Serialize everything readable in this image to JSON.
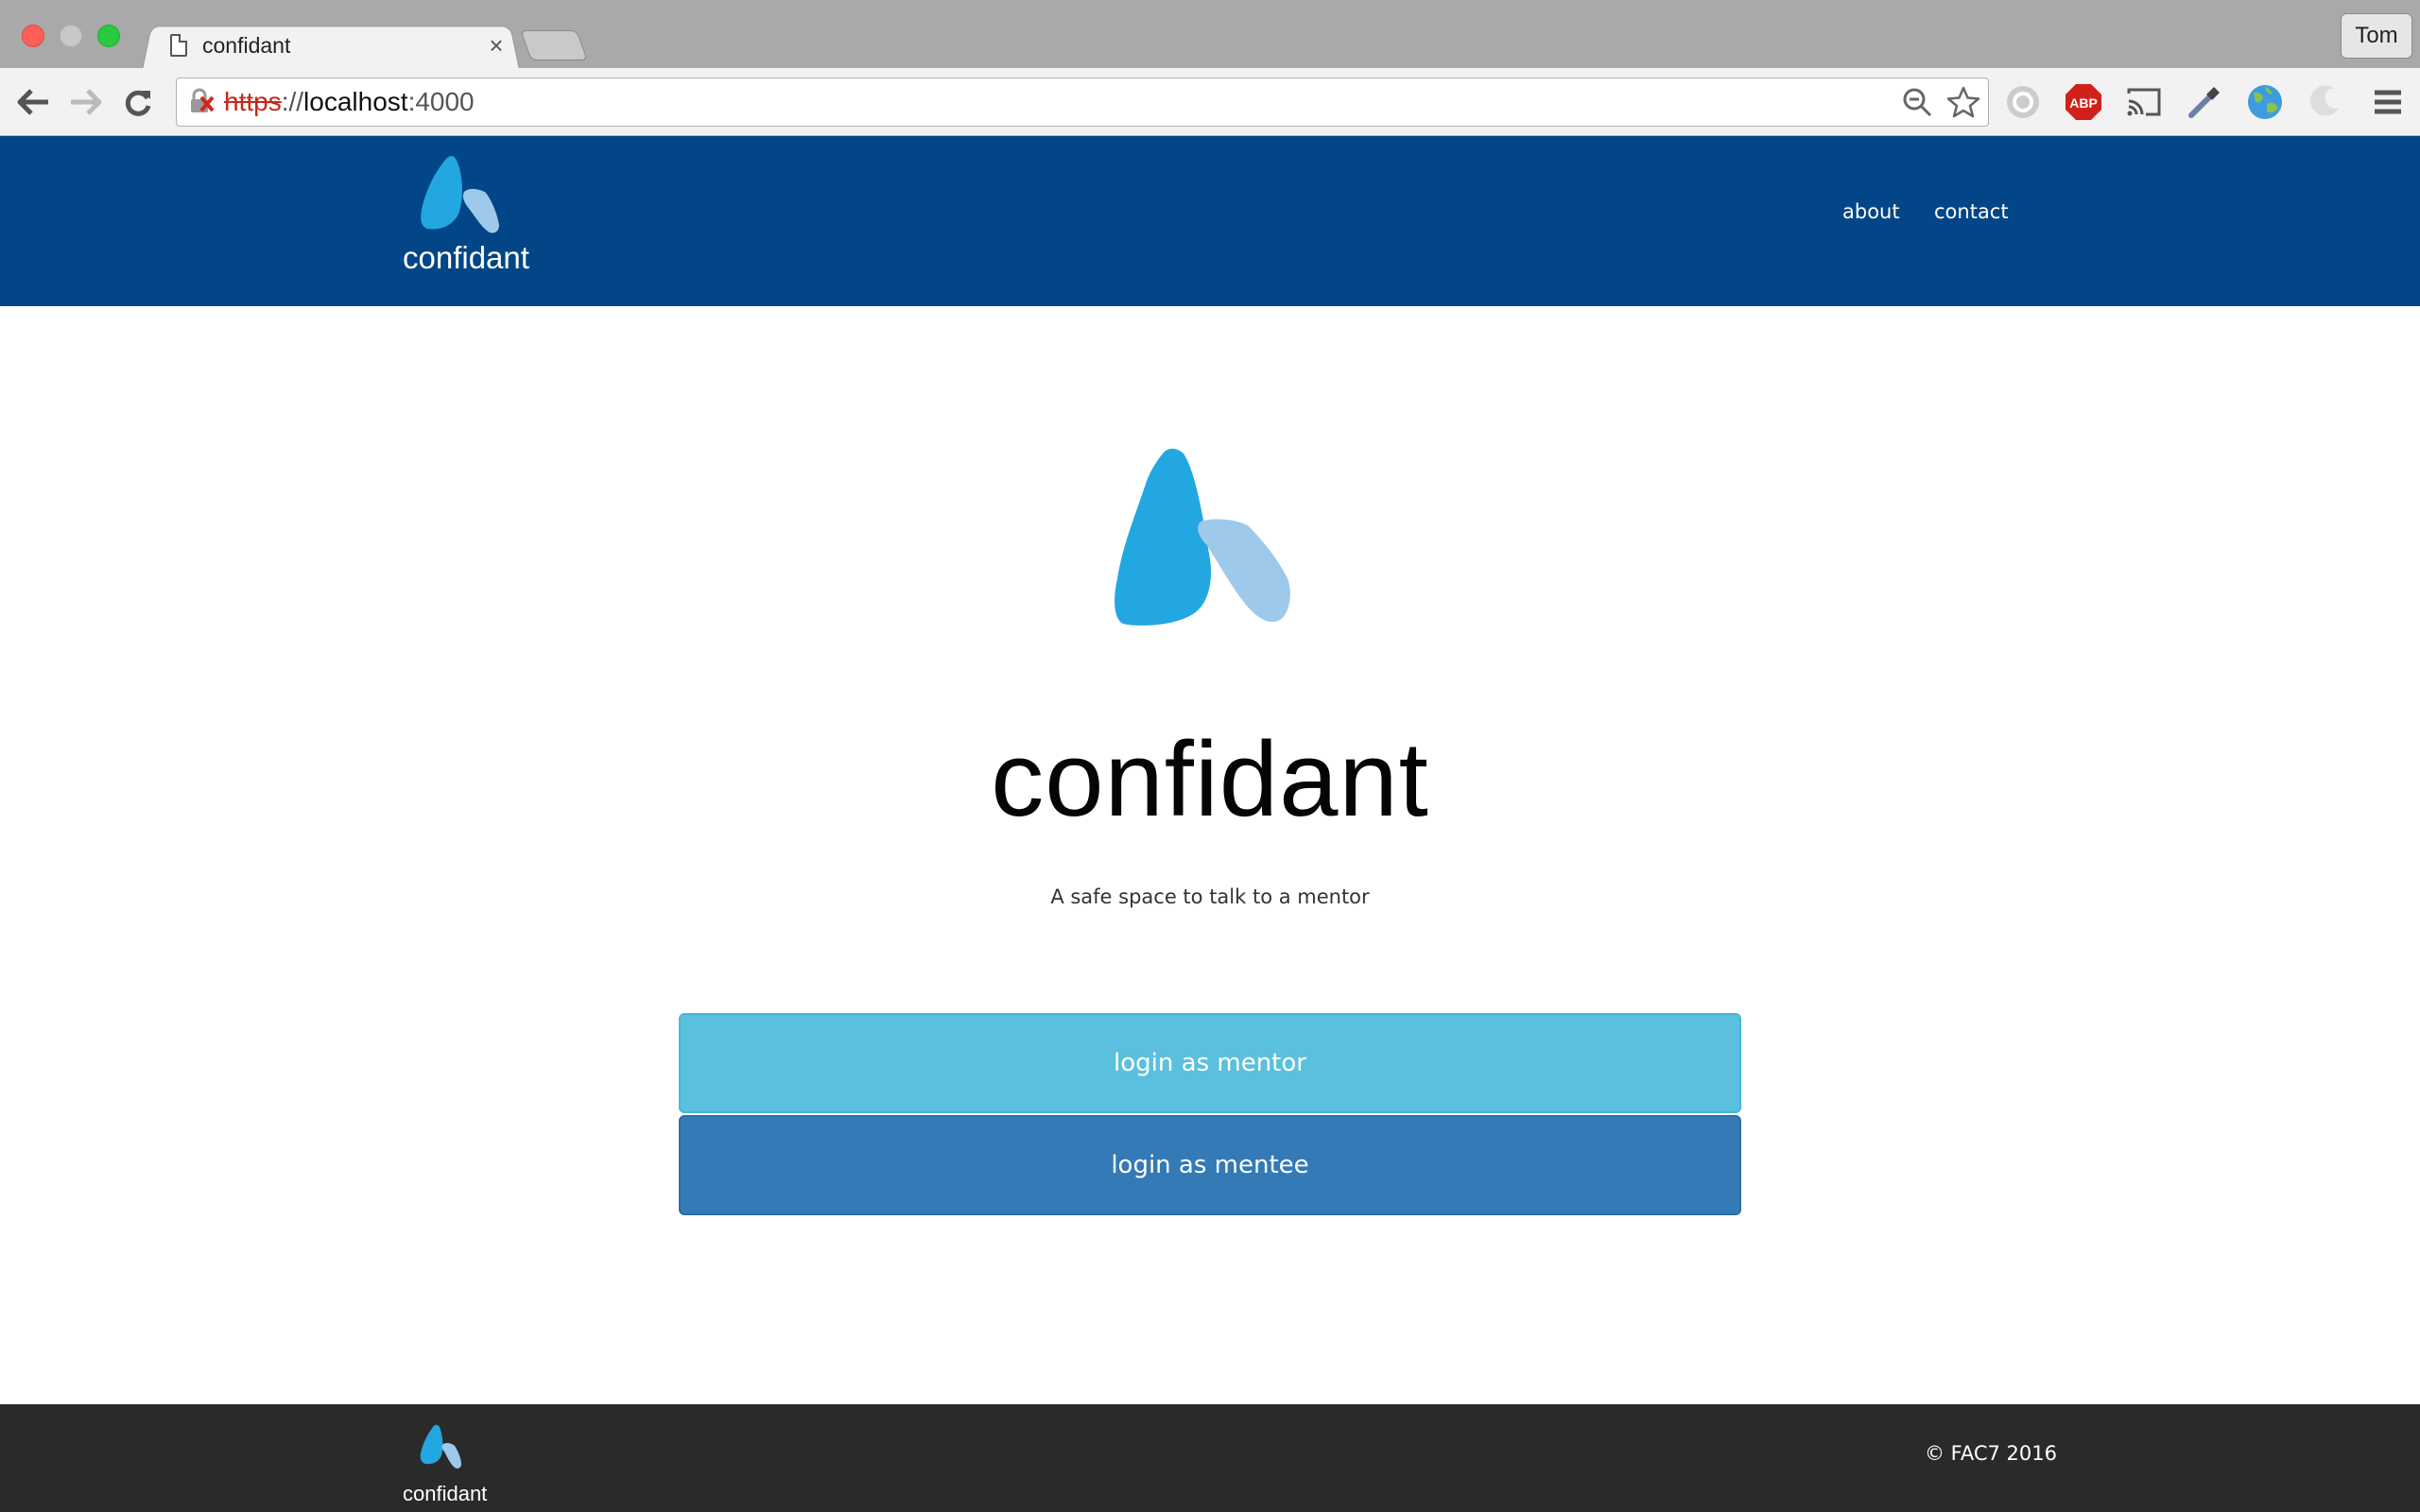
{
  "browser": {
    "tab_title": "confidant",
    "tab_close": "×",
    "profile_name": "Tom",
    "url": {
      "scheme": "https",
      "sep": "://",
      "host": "localhost",
      "port": ":4000"
    },
    "extensions": [
      "zoom-icon",
      "bookmark-star-icon",
      "extension-grey-icon",
      "adblock-icon",
      "cast-icon",
      "eyedropper-icon",
      "globe-icon",
      "extension-swirl-icon",
      "menu-icon"
    ],
    "adblock_label": "ABP"
  },
  "header": {
    "logo_text": "confidant",
    "nav": [
      {
        "label": "about"
      },
      {
        "label": "contact"
      }
    ]
  },
  "hero": {
    "title": "confidant",
    "tagline": "A safe space to talk to a mentor"
  },
  "actions": {
    "mentor_label": "login as mentor",
    "mentee_label": "login as mentee"
  },
  "footer": {
    "logo_text": "confidant",
    "copyright": "© FAC7 2016"
  },
  "colors": {
    "header_bg": "#034687",
    "footer_bg": "#2a2a2a",
    "logo_dark": "#22a7e1",
    "logo_light": "#9fc9ea",
    "mentor_btn": "#5bc0de",
    "mentee_btn": "#337ab7"
  }
}
